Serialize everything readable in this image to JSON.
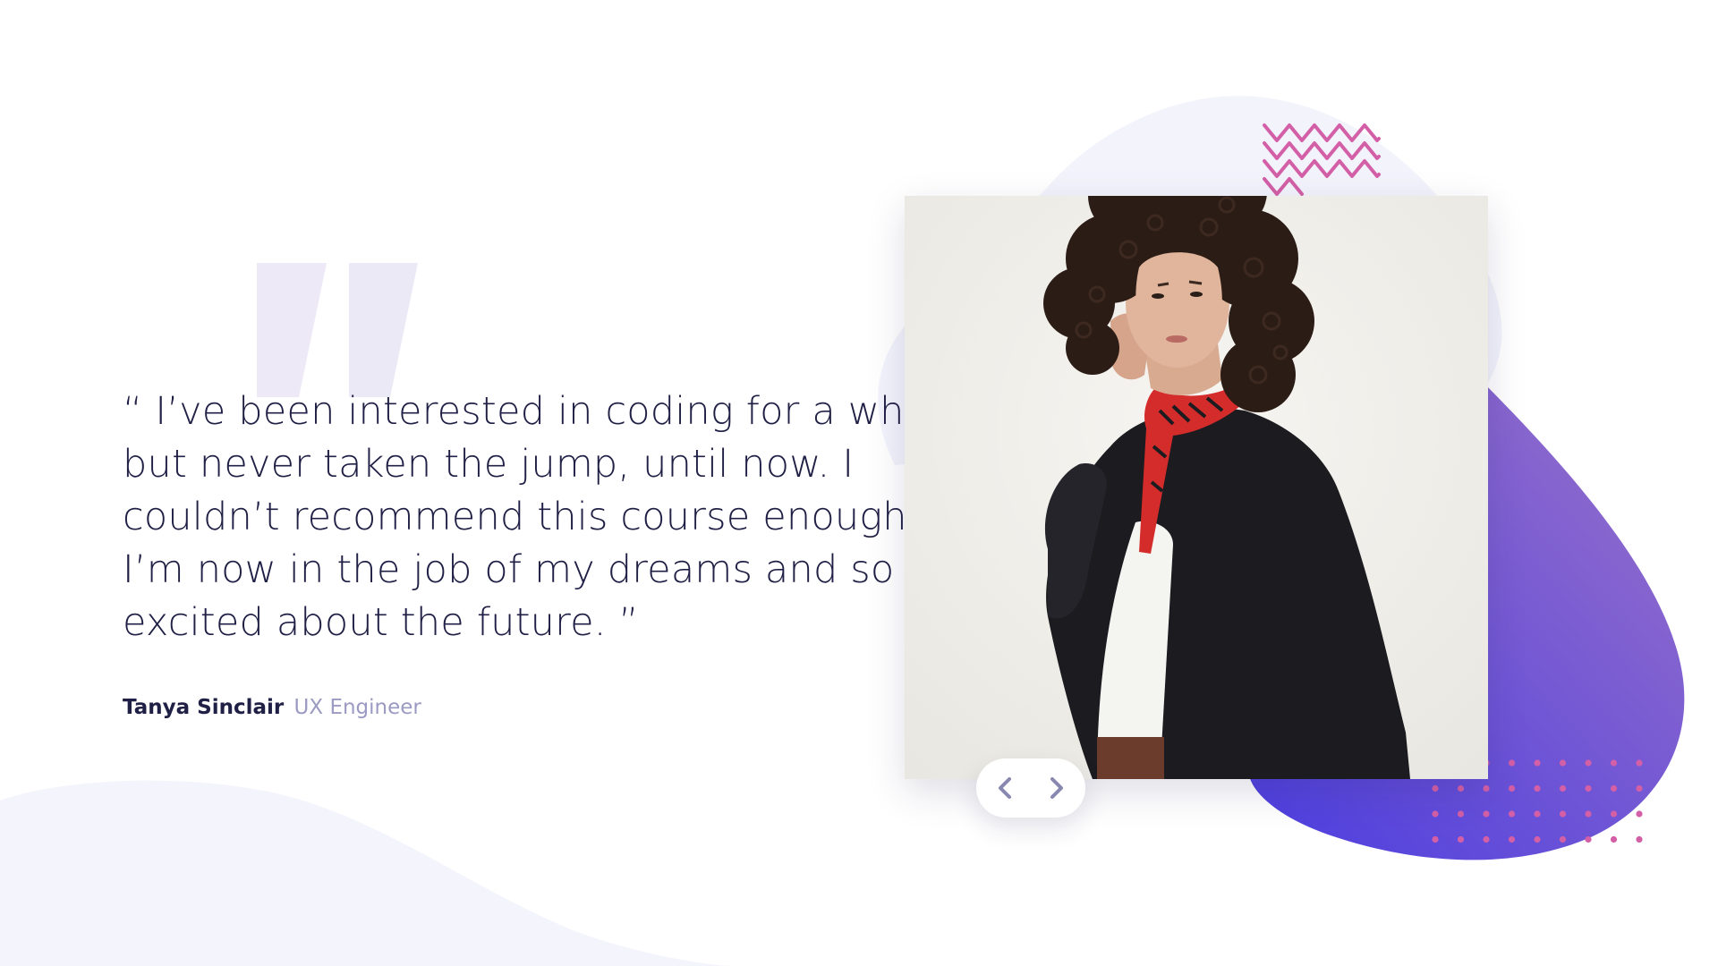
{
  "testimonial": {
    "quote": "“ I’ve been interested in coding for a while\nbut never taken the jump, until now. I\ncouldn’t recommend this course enough.\nI’m now in the job of my dreams and so\nexcited about the future. ”",
    "author_name": "Tanya Sinclair",
    "author_role": "UX Engineer"
  },
  "photo": {
    "alt": "Tanya Sinclair"
  },
  "slider": {
    "prev_icon": "chevron-left-icon",
    "next_icon": "chevron-right-icon"
  },
  "colors": {
    "text_dark": "#202046",
    "text_muted": "#9a9ac2",
    "bg_curve": "#f4f4fc",
    "quote_mark": "#ebe9f6",
    "purple_gradient_start": "#4b3de0",
    "purple_gradient_end": "#8f6ccd",
    "pink_accent": "#d35fa6",
    "chevron": "#8888b0"
  }
}
